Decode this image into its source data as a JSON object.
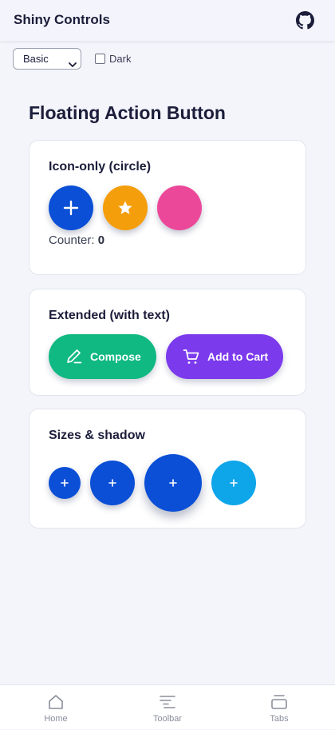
{
  "app": {
    "title": "Shiny Controls",
    "github_icon": "github-icon"
  },
  "controls": {
    "theme_select": {
      "selected": "Basic",
      "icon": "chevron-down-icon"
    },
    "dark_toggle": {
      "label": "Dark",
      "checked": false
    }
  },
  "page": {
    "title": "Floating Action Button"
  },
  "cards": {
    "icon_only": {
      "title": "Icon-only (circle)",
      "buttons": [
        {
          "icon": "plus-icon",
          "color": "#0a4fd6"
        },
        {
          "icon": "star-icon",
          "color": "#f59e0b"
        },
        {
          "icon": "none",
          "color": "#ec4899"
        }
      ],
      "counter_label": "Counter:",
      "counter_value": "0"
    },
    "extended": {
      "title": "Extended (with text)",
      "buttons": [
        {
          "label": "Compose",
          "icon": "pencil-icon",
          "color": "#10b981"
        },
        {
          "label": "Add to Cart",
          "icon": "cart-icon",
          "color": "#7c3aed"
        }
      ]
    },
    "sizes": {
      "title": "Sizes & shadow",
      "buttons": [
        {
          "size": "small",
          "icon": "plus-icon",
          "color": "#0a4fd6"
        },
        {
          "size": "medium",
          "icon": "plus-icon",
          "color": "#0a4fd6"
        },
        {
          "size": "large",
          "icon": "plus-icon",
          "color": "#0a4fd6"
        },
        {
          "size": "medium",
          "icon": "plus-icon",
          "color": "#0ea5e9"
        }
      ]
    }
  },
  "nav": {
    "items": [
      {
        "label": "Home",
        "icon": "home-icon"
      },
      {
        "label": "Toolbar",
        "icon": "toolbar-icon"
      },
      {
        "label": "Tabs",
        "icon": "tabs-icon"
      }
    ]
  }
}
